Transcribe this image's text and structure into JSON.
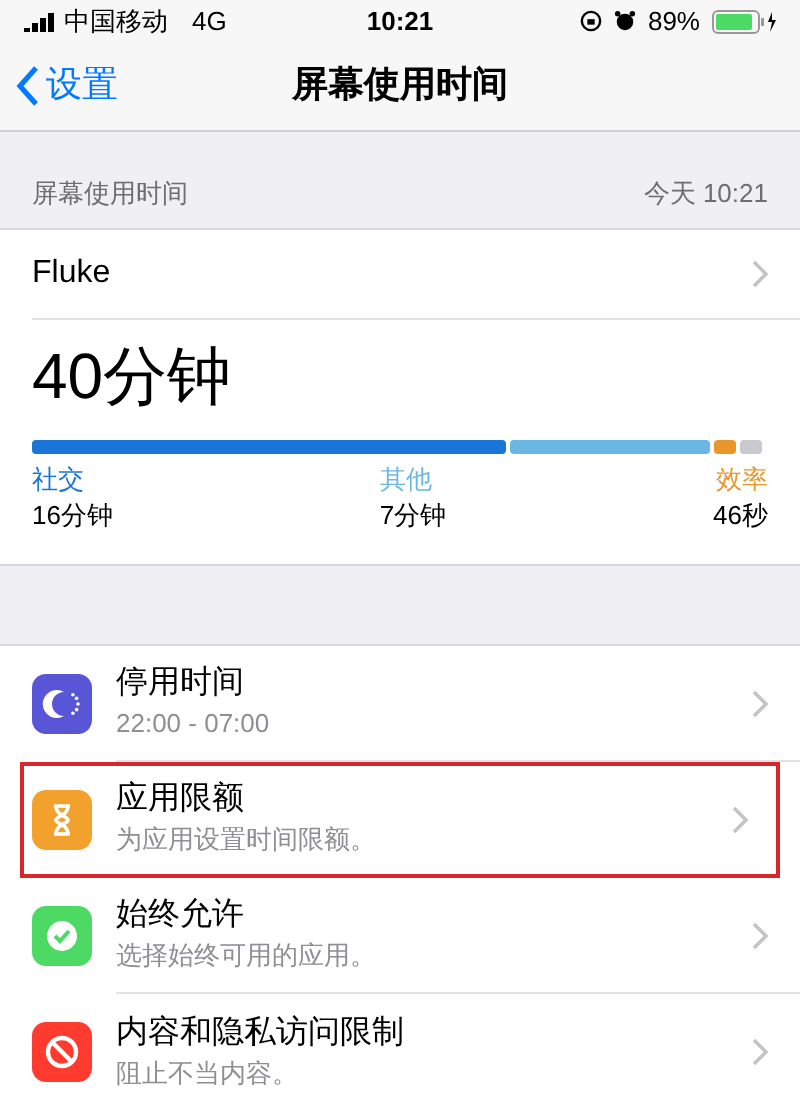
{
  "status_bar": {
    "carrier": "中国移动",
    "network": "4G",
    "time": "10:21",
    "battery": "89%"
  },
  "nav": {
    "back": "设置",
    "title": "屏幕使用时间"
  },
  "section_header": {
    "label": "屏幕使用时间",
    "date": "今天 10:21"
  },
  "device": {
    "name": "Fluke"
  },
  "total": "40分钟",
  "usage": [
    {
      "category": "社交",
      "duration": "16分钟",
      "color": "#1a75d8"
    },
    {
      "category": "其他",
      "duration": "7分钟",
      "color": "#6ab7e3"
    },
    {
      "category": "效率",
      "duration": "46秒",
      "color": "#e9962b"
    },
    {
      "color": "#c9c9ce"
    }
  ],
  "settings": [
    {
      "kind": "downtime",
      "title": "停用时间",
      "subtitle": "22:00 - 07:00",
      "highlighted": false
    },
    {
      "kind": "limits",
      "title": "应用限额",
      "subtitle": "为应用设置时间限额。",
      "highlighted": true
    },
    {
      "kind": "allowed",
      "title": "始终允许",
      "subtitle": "选择始终可用的应用。",
      "highlighted": false
    },
    {
      "kind": "restrictions",
      "title": "内容和隐私访问限制",
      "subtitle": "阻止不当内容。",
      "highlighted": false
    }
  ]
}
